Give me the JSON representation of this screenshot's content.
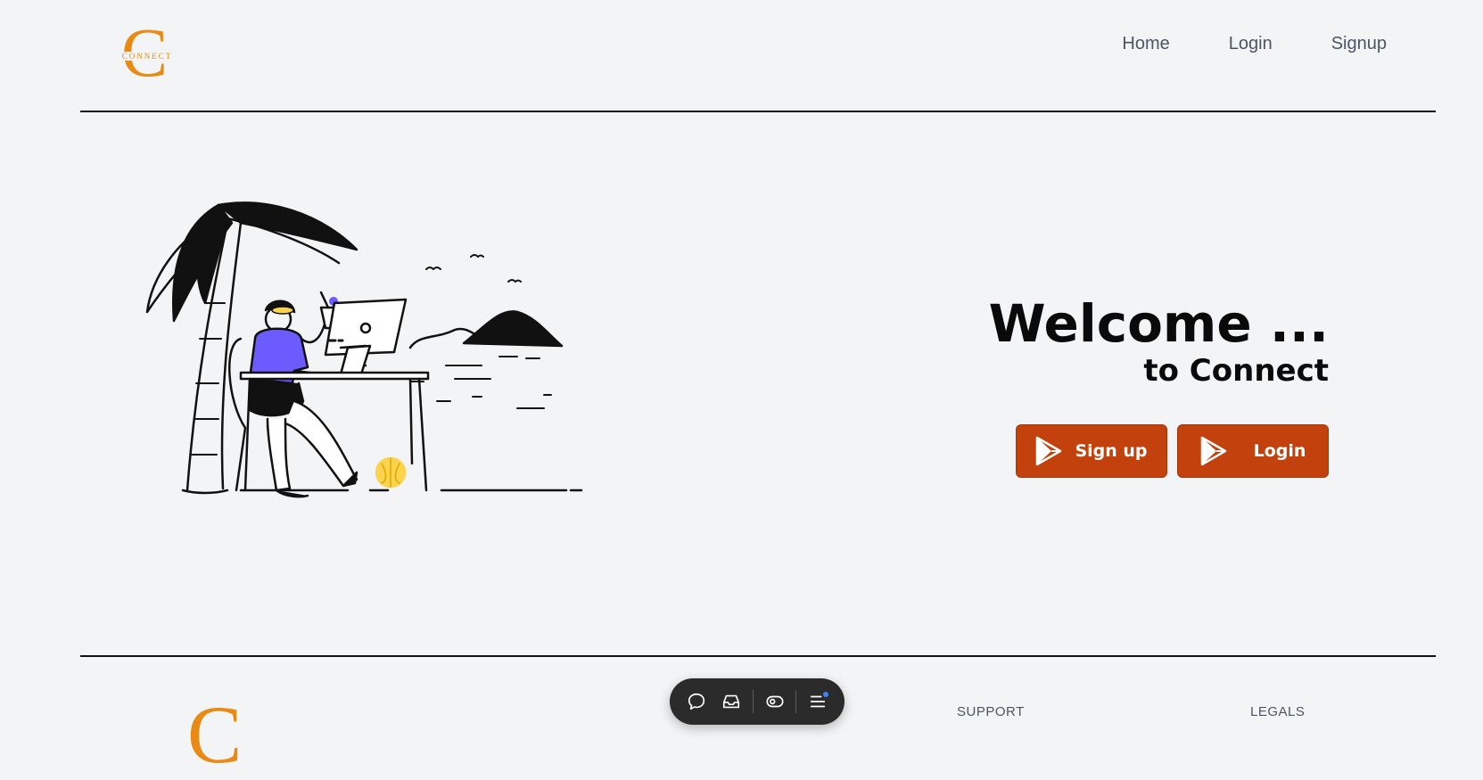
{
  "header": {
    "logo_letter": "C",
    "logo_word": "CONNECT",
    "nav": [
      "Home",
      "Login",
      "Signup"
    ]
  },
  "hero": {
    "title": "Welcome ...",
    "subtitle": "to Connect",
    "signup_label": "Sign up",
    "login_label": "Login",
    "button_color": "#c2410c"
  },
  "footer": {
    "logo_letter": "C",
    "support": "SUPPORT",
    "legals": "LEGALS"
  },
  "toolbar": {
    "icons": [
      "chat-icon",
      "inbox-icon",
      "eye-icon",
      "menu-icon"
    ],
    "notification_color": "#3b82f6"
  },
  "colors": {
    "brand_orange": "#e88a14",
    "background": "#f3f4f6",
    "illustration_purple": "#6c5cff",
    "illustration_yellow": "#fcd34d"
  }
}
